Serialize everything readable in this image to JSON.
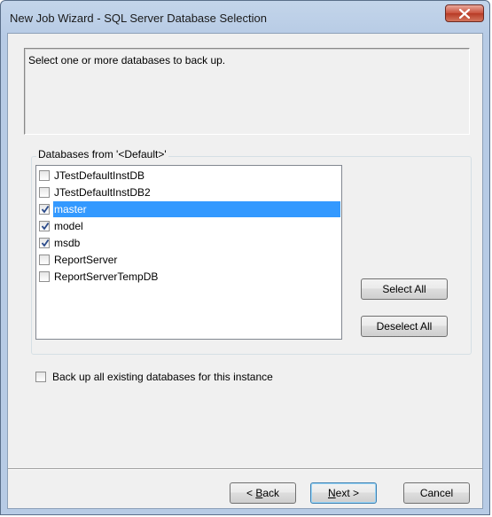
{
  "window": {
    "title": "New Job Wizard - SQL Server Database Selection"
  },
  "description": "Select one or more databases to back up.",
  "databases": {
    "group_label": "Databases from '<Default>'",
    "items": [
      {
        "name": "JTestDefaultInstDB",
        "checked": false,
        "selected": false
      },
      {
        "name": "JTestDefaultInstDB2",
        "checked": false,
        "selected": false
      },
      {
        "name": "master",
        "checked": true,
        "selected": true
      },
      {
        "name": "model",
        "checked": true,
        "selected": false
      },
      {
        "name": "msdb",
        "checked": true,
        "selected": false
      },
      {
        "name": "ReportServer",
        "checked": false,
        "selected": false
      },
      {
        "name": "ReportServerTempDB",
        "checked": false,
        "selected": false
      }
    ],
    "select_all_label": "Select All",
    "deselect_all_label": "Deselect All"
  },
  "backup_all": {
    "label": "Back up all existing databases for this instance",
    "checked": false
  },
  "footer": {
    "back_prefix": "< ",
    "back_mnemonic": "B",
    "back_rest": "ack",
    "next_mnemonic": "N",
    "next_rest": "ext >",
    "cancel_label": "Cancel"
  },
  "colors": {
    "selection": "#3399ff",
    "titlebar": "#b7cbe5",
    "close_button": "#c8503b"
  }
}
